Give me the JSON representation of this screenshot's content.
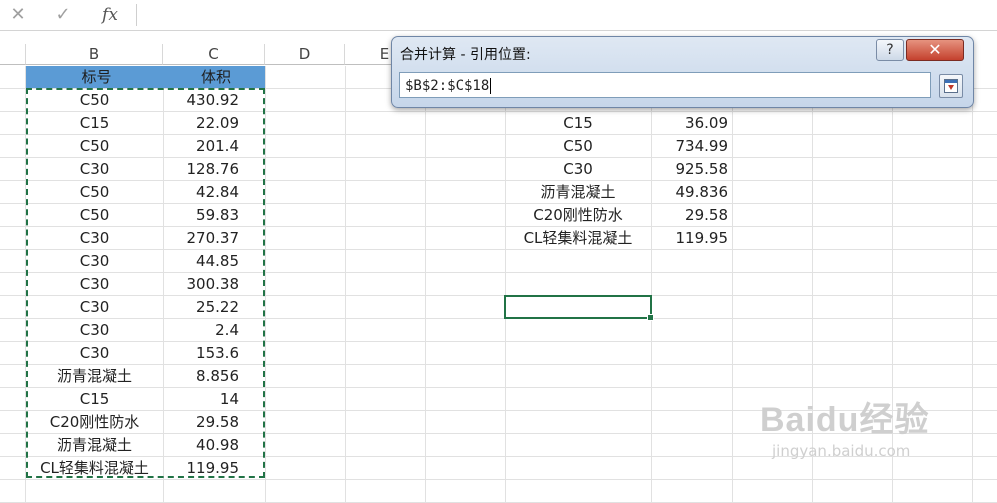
{
  "formula_bar": {
    "cancel_icon": "close-icon",
    "confirm_icon": "check-icon",
    "fx_label": "fx",
    "value": ""
  },
  "columns": [
    "B",
    "C",
    "D",
    "E"
  ],
  "left_table": {
    "headers": [
      "标号",
      "体积"
    ],
    "rows": [
      [
        "C50",
        "430.92"
      ],
      [
        "C15",
        "22.09"
      ],
      [
        "C50",
        "201.4"
      ],
      [
        "C30",
        "128.76"
      ],
      [
        "C50",
        "42.84"
      ],
      [
        "C50",
        "59.83"
      ],
      [
        "C30",
        "270.37"
      ],
      [
        "C30",
        "44.85"
      ],
      [
        "C30",
        "300.38"
      ],
      [
        "C30",
        "25.22"
      ],
      [
        "C30",
        "2.4"
      ],
      [
        "C30",
        "153.6"
      ],
      [
        "沥青混凝土",
        "8.856"
      ],
      [
        "C15",
        "14"
      ],
      [
        "C20刚性防水",
        "29.58"
      ],
      [
        "沥青混凝土",
        "40.98"
      ],
      [
        "CL轻集料混凝土",
        "119.95"
      ]
    ]
  },
  "right_table": {
    "rows": [
      [
        "C15",
        "36.09"
      ],
      [
        "C50",
        "734.99"
      ],
      [
        "C30",
        "925.58"
      ],
      [
        "沥青混凝土",
        "49.836"
      ],
      [
        "C20刚性防水",
        "29.58"
      ],
      [
        "CL轻集料混凝土",
        "119.95"
      ]
    ]
  },
  "dialog": {
    "title": "合并计算 - 引用位置:",
    "help_label": "?",
    "close_label": "✕",
    "reference_value": "$B$2:$C$18"
  },
  "watermark": {
    "logo": "Baidu经验",
    "url": "jingyan.baidu.com"
  },
  "colors": {
    "header_fill": "#5b9bd5",
    "selection": "#217346"
  }
}
